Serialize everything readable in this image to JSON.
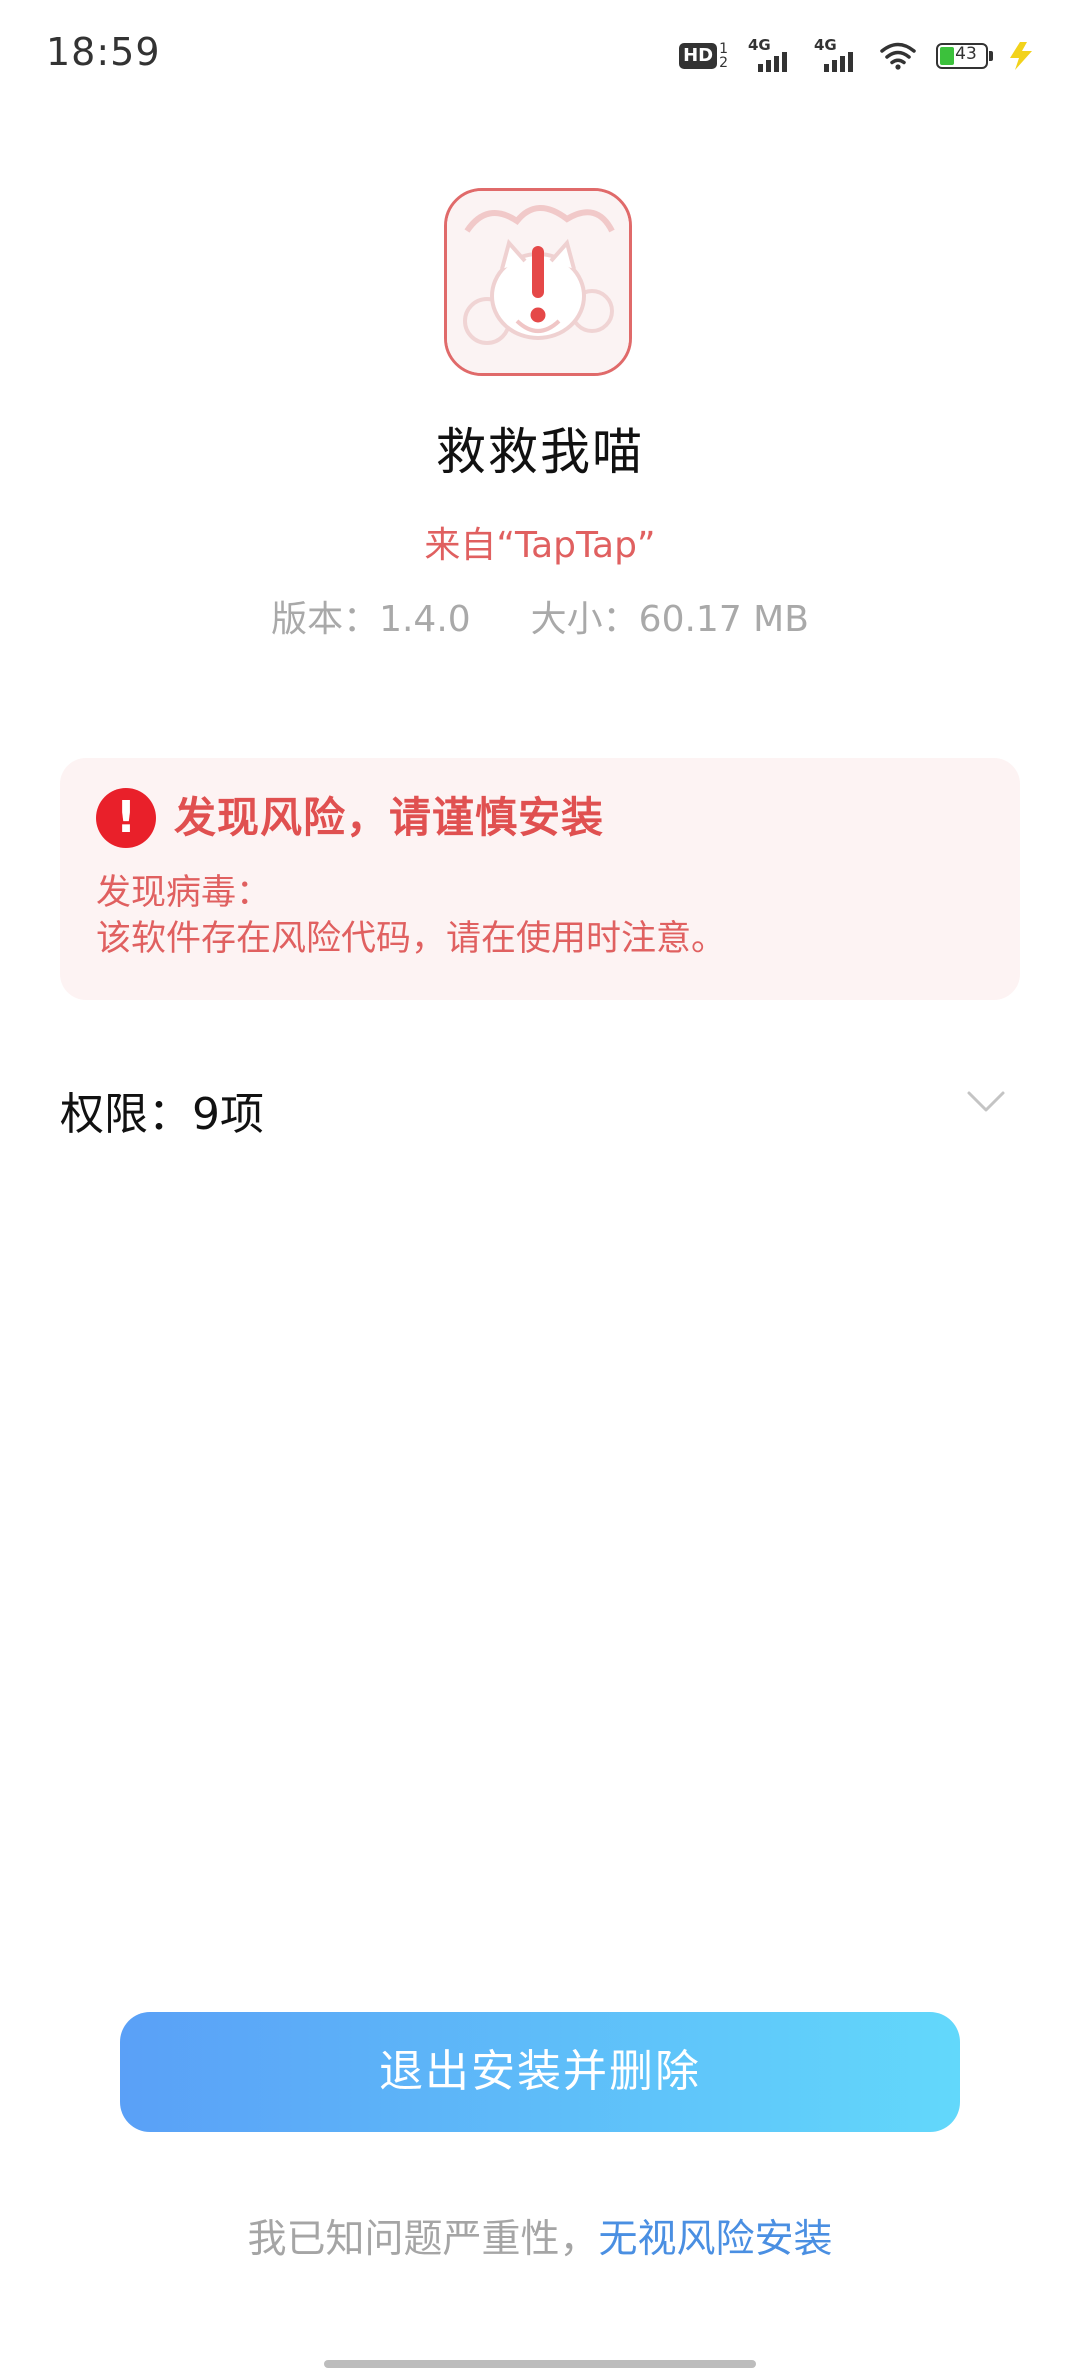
{
  "status_bar": {
    "time": "18:59",
    "hd_label": "HD",
    "hd_digit_top": "1",
    "hd_digit_bottom": "2",
    "sim1_network": "4G",
    "sim2_network": "4G",
    "battery_level": "43",
    "icons": [
      "hd-icon",
      "signal-icon",
      "signal-icon",
      "wifi-icon",
      "battery-icon",
      "charging-icon"
    ]
  },
  "app": {
    "name": "救救我喵",
    "source": "来自“TapTap”",
    "version": "版本：1.4.0",
    "size": "大小：60.17 MB",
    "icon": "app-icon-with-warning"
  },
  "risk": {
    "icon_glyph": "!",
    "title": "发现风险，请谨慎安装",
    "label": "发现病毒：",
    "description": "该软件存在风险代码，请在使用时注意。",
    "accent_color": "#e9202a"
  },
  "permissions": {
    "label": "权限：9项"
  },
  "actions": {
    "primary_label": "退出安装并删除",
    "footer_prefix": "我已知问题严重性，",
    "footer_link": "无视风险安装"
  },
  "colors": {
    "warning_text": "#e06060",
    "button_gradient_start": "#5aa0f7",
    "button_gradient_end": "#62d8fb",
    "link": "#4a8fe2"
  }
}
